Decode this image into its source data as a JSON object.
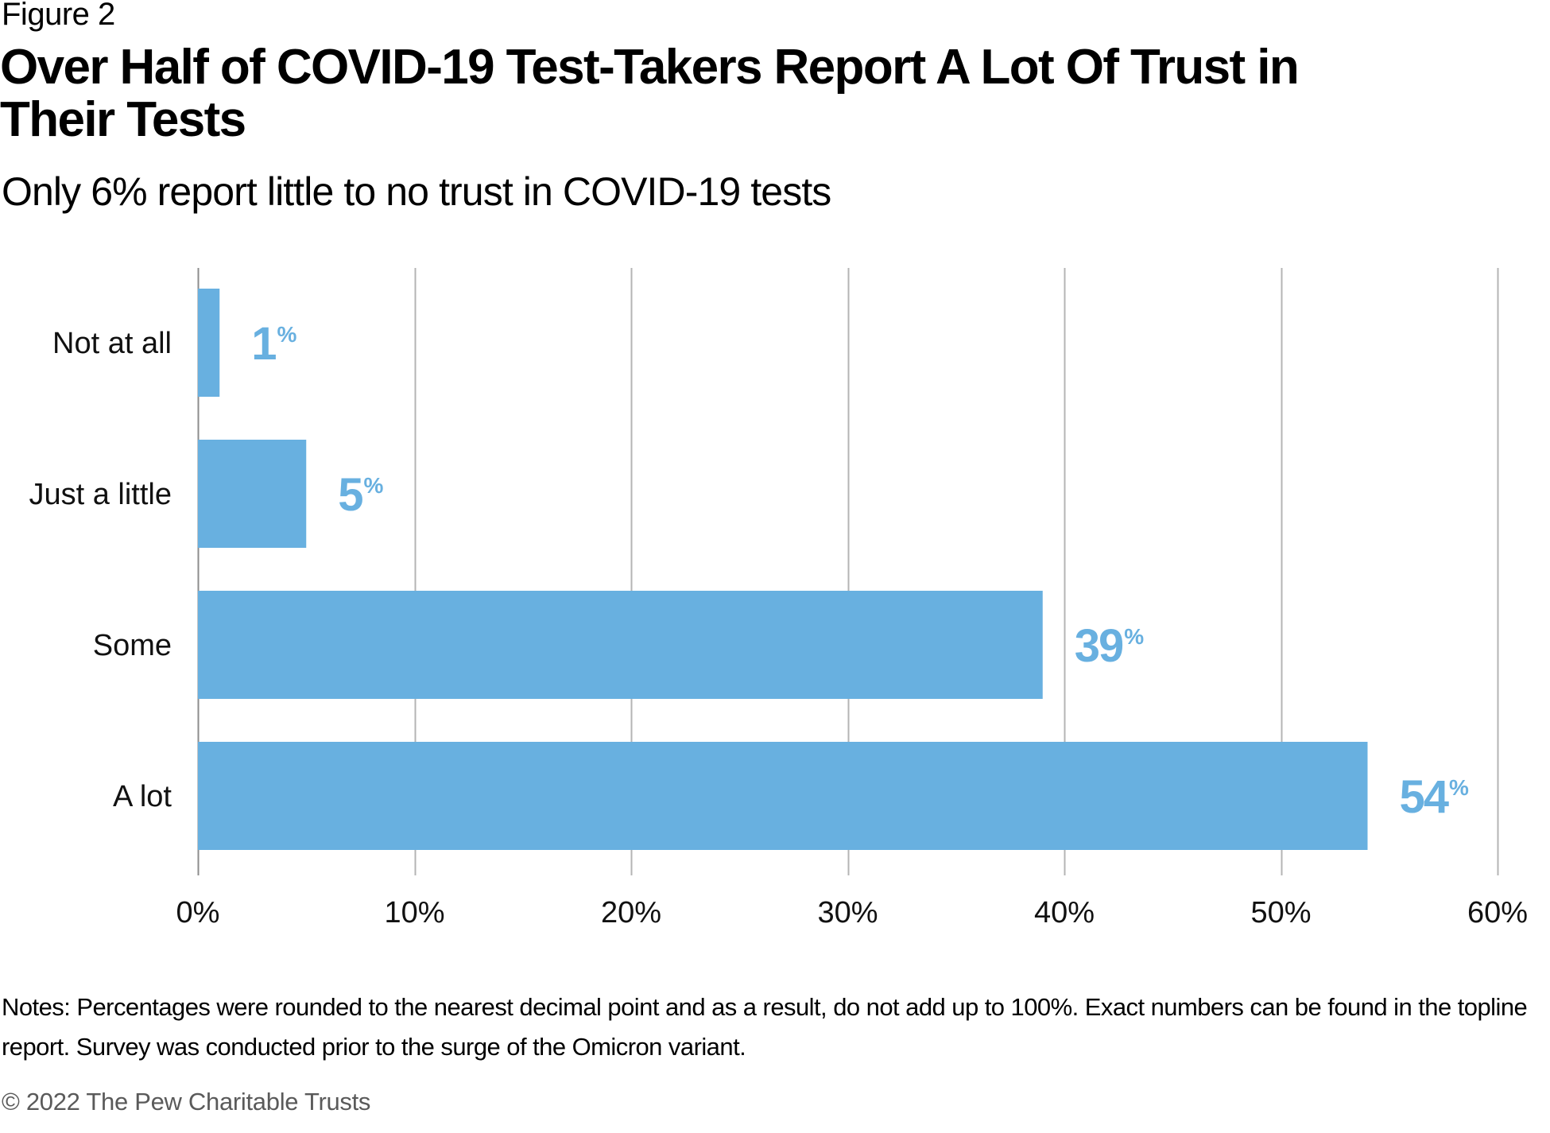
{
  "figure_label": "Figure 2",
  "title": "Over Half of COVID-19 Test-Takers Report A Lot Of Trust in Their Tests",
  "subtitle": "Only 6% report little to no trust in COVID-19 tests",
  "notes": "Notes: Percentages were rounded to the nearest decimal point and as a result, do not add up to 100%. Exact numbers can be found in the topline report. Survey was conducted prior to the surge of the Omicron variant.",
  "copyright": "© 2022 The Pew Charitable Trusts",
  "colors": {
    "bar": "#68b0e0",
    "value_label": "#68b0e0",
    "gridline": "#b4b4b4",
    "axis": "#8c8c8c"
  },
  "chart_data": {
    "type": "bar",
    "orientation": "horizontal",
    "title": "Over Half of COVID-19 Test-Takers Report A Lot Of Trust in Their Tests",
    "subtitle": "Only 6% report little to no trust in COVID-19 tests",
    "categories": [
      "Not at all",
      "Just a little",
      "Some",
      "A lot"
    ],
    "values": [
      1,
      5,
      39,
      54
    ],
    "value_labels": [
      "1",
      "5",
      "39",
      "54"
    ],
    "value_suffix": "%",
    "xlabel": "",
    "ylabel": "",
    "xlim": [
      0,
      60
    ],
    "xticks": [
      0,
      10,
      20,
      30,
      40,
      50,
      60
    ],
    "xtick_labels": [
      "0%",
      "10%",
      "20%",
      "30%",
      "40%",
      "50%",
      "60%"
    ],
    "grid": "vertical",
    "legend": "none"
  }
}
